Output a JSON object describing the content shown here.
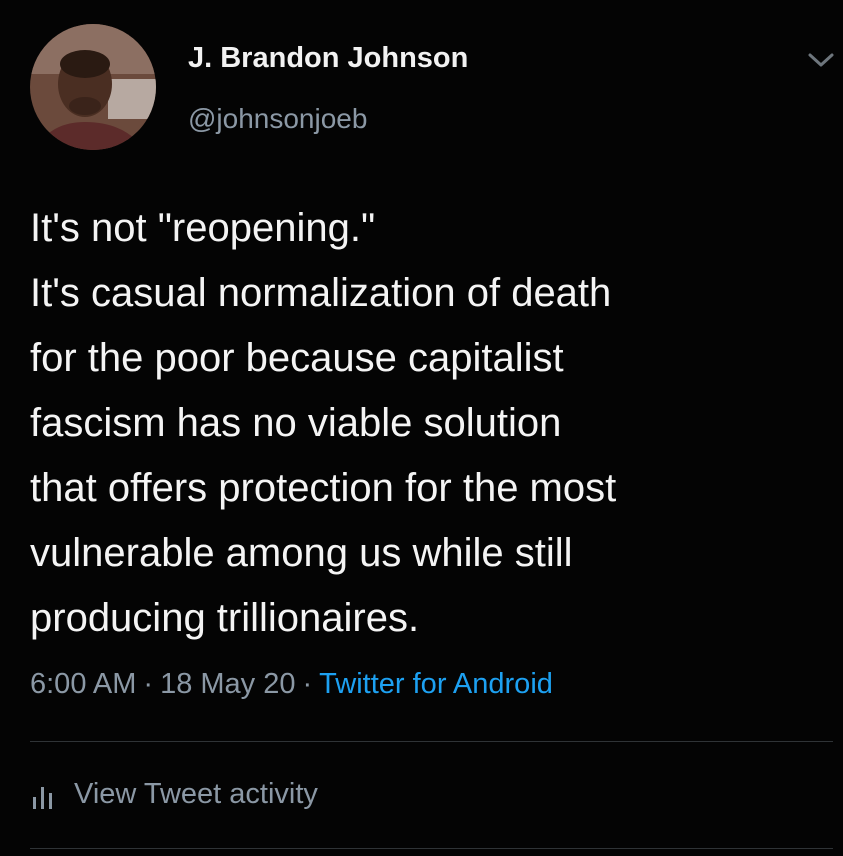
{
  "author": {
    "display_name": "J. Brandon Johnson",
    "handle": "@johnsonjoeb",
    "avatar_icon": "user-avatar"
  },
  "tweet": {
    "lines": [
      "It's not \"reopening.\"",
      "It's casual normalization of death",
      "for the poor because capitalist",
      "fascism has no viable solution",
      "that offers protection for the most",
      "vulnerable among us while still",
      "producing trillionaires."
    ]
  },
  "meta": {
    "time": "6:00 AM",
    "separator": "·",
    "date": "18 May 20",
    "source": "Twitter for Android"
  },
  "activity": {
    "label": "View Tweet activity",
    "icon": "bar-chart-icon"
  },
  "colors": {
    "background": "#040404",
    "text": "#f4f4f4",
    "secondary": "#8b98a5",
    "link": "#1da1f2",
    "divider": "#2f3336"
  }
}
